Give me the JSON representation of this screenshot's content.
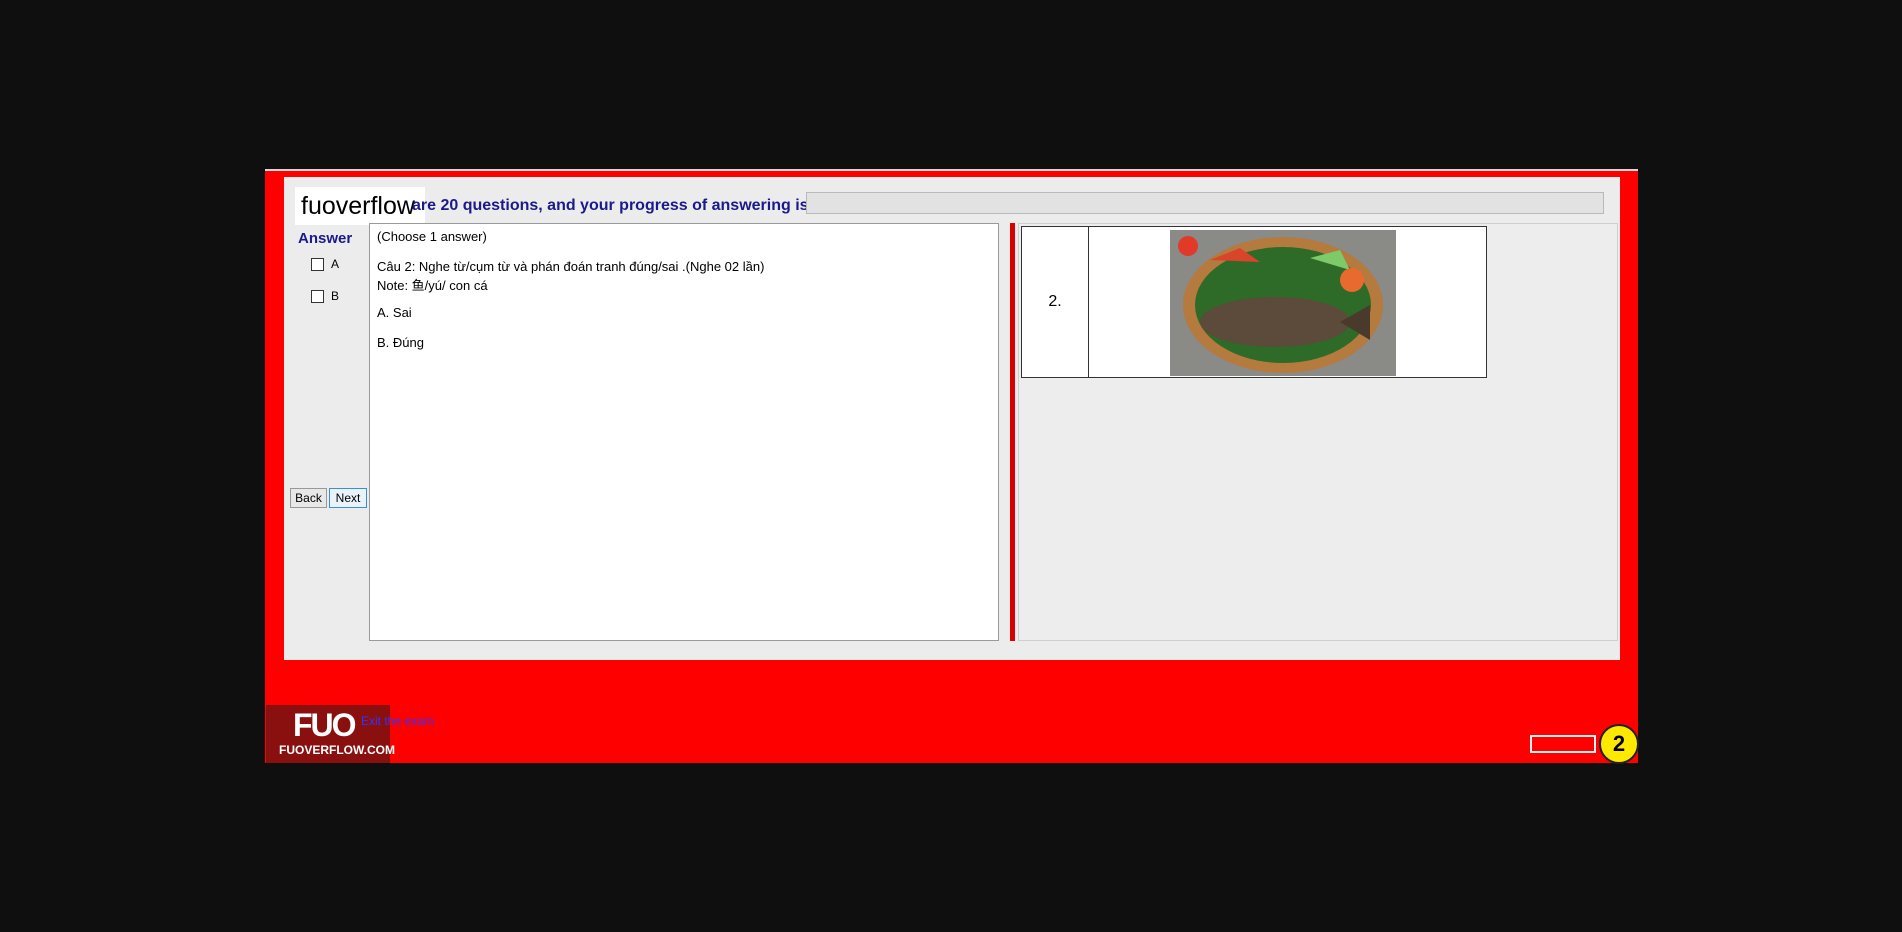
{
  "brand": {
    "name": "fuoverflow"
  },
  "progress": {
    "text": "are 20 questions, and your progress of answering is",
    "value": 0
  },
  "answer_panel": {
    "title": "Answer",
    "options": [
      {
        "label": "A"
      },
      {
        "label": "B"
      }
    ],
    "back_label": "Back",
    "next_label": "Next"
  },
  "question": {
    "instruction": "(Choose 1 answer)",
    "prompt": "Câu 2: Nghe từ/cụm từ và phán đoán tranh đúng/sai .(Nghe 02 lần)",
    "note": "Note: 鱼/yú/ con cá",
    "choices": [
      "A.  Sai",
      "B.  Đúng"
    ]
  },
  "image_table": {
    "row_number": "2."
  },
  "footer": {
    "logo_text": "FUO",
    "logo_sub": "FUOVERFLOW.COM",
    "exit_text": "Exit the exam",
    "badge": "2"
  }
}
